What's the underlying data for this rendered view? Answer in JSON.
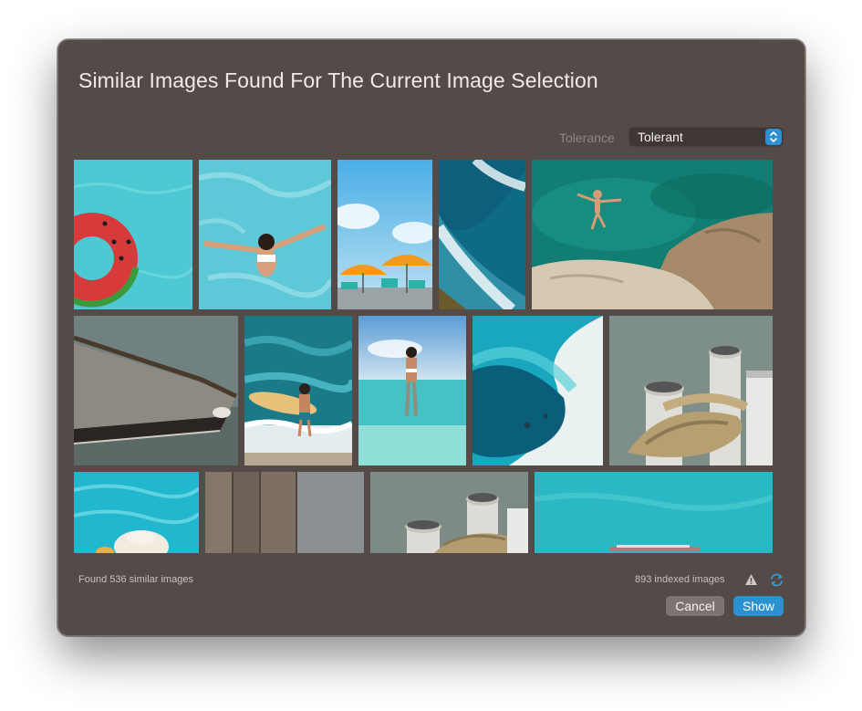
{
  "dialog": {
    "title": "Similar Images Found For The Current Image Selection"
  },
  "tolerance": {
    "label": "Tolerance",
    "value": "Tolerant"
  },
  "thumbnails": [
    {
      "name": "swim-ring-water"
    },
    {
      "name": "woman-floating-pool"
    },
    {
      "name": "beach-umbrellas"
    },
    {
      "name": "aerial-waves"
    },
    {
      "name": "cliff-jumper"
    },
    {
      "name": "wooden-boat"
    },
    {
      "name": "surfer-with-board"
    },
    {
      "name": "woman-in-sea"
    },
    {
      "name": "aerial-lagoon"
    },
    {
      "name": "bollard-rope"
    },
    {
      "name": "hat-in-pool"
    },
    {
      "name": "wooden-planks"
    },
    {
      "name": "bollard-rope-2"
    },
    {
      "name": "turquoise-water-boat"
    }
  ],
  "footer": {
    "found_text": "Found 536 similar images",
    "indexed_text": "893 indexed images",
    "warning_icon": "warning-icon",
    "refresh_icon": "refresh-icon",
    "cancel_label": "Cancel",
    "show_label": "Show"
  },
  "colors": {
    "dialog_bg": "#544b48",
    "accent": "#2a93cf"
  }
}
